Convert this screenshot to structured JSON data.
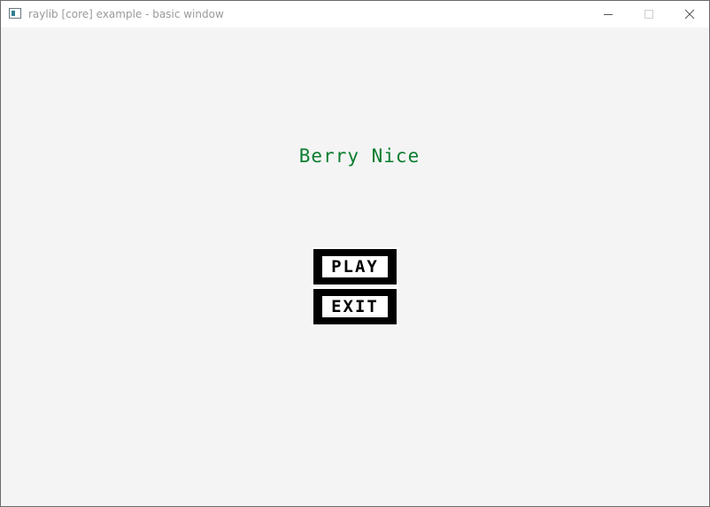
{
  "window": {
    "title": "raylib [core] example - basic window",
    "controls": {
      "minimize_icon": "minimize-icon",
      "maximize_icon": "maximize-icon",
      "close_icon": "close-icon"
    }
  },
  "game": {
    "title": "Berry Nice",
    "title_color": "#0a7d2f",
    "background": "#f4f4f4",
    "menu": {
      "play_label": "PLAY",
      "exit_label": "EXIT"
    }
  }
}
